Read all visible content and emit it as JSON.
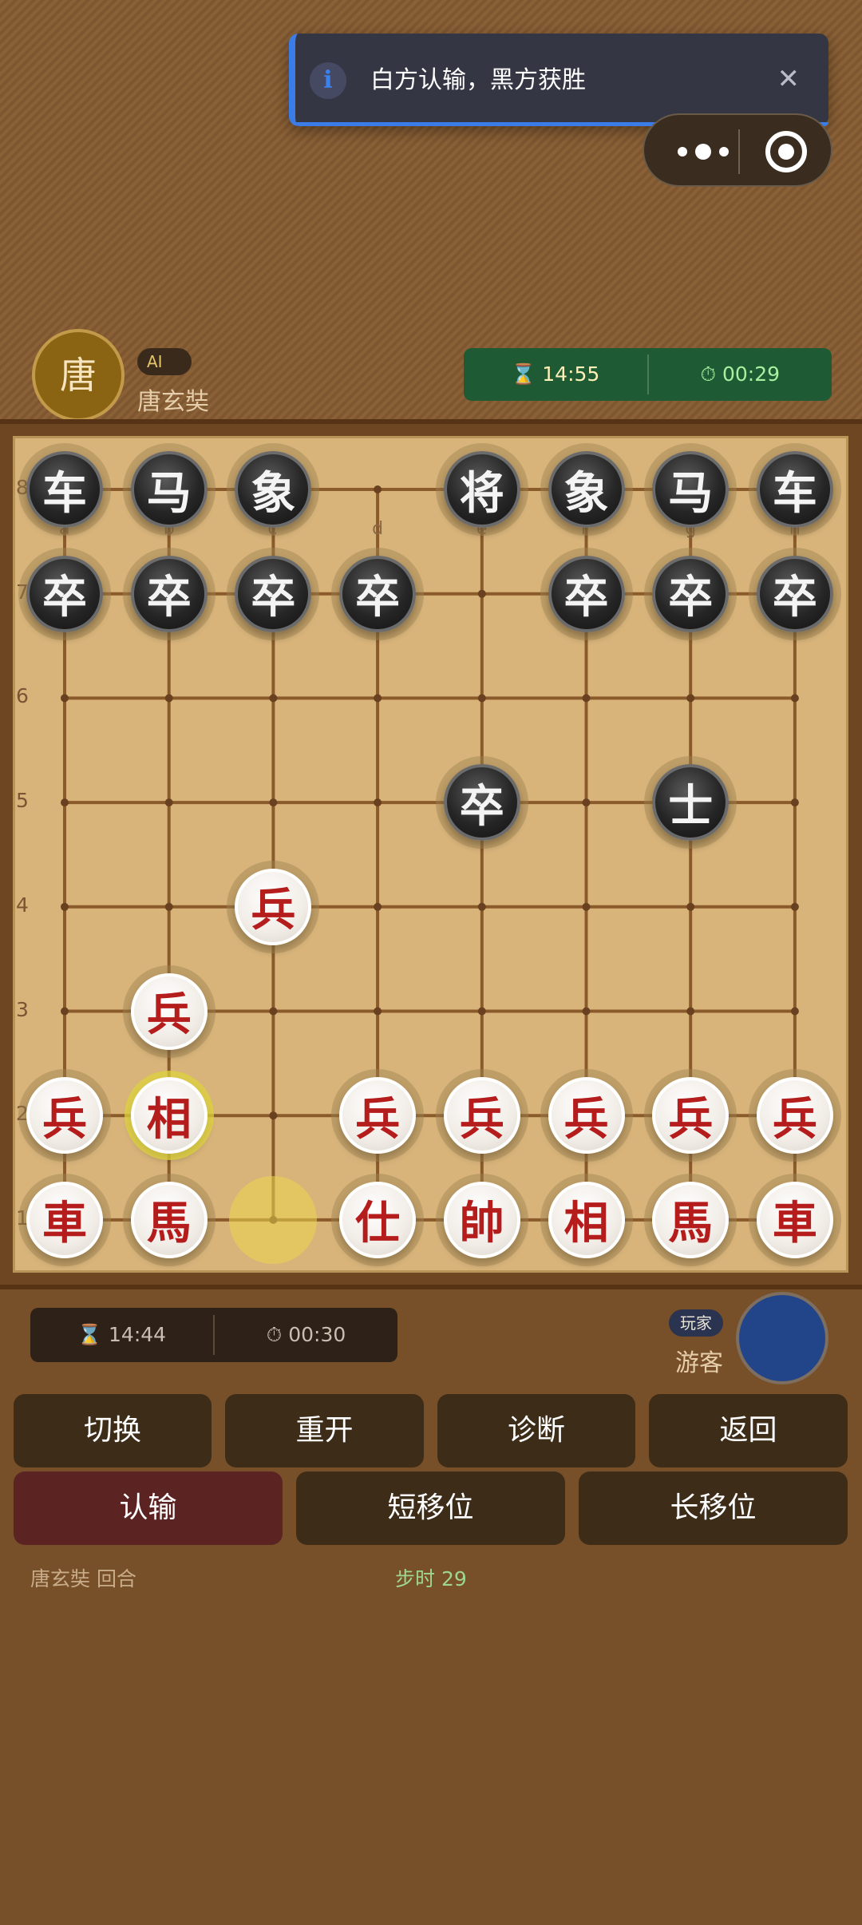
{
  "toast": {
    "icon": "info-icon",
    "message": "白方认输，黑方获胜",
    "close_label": "✕"
  },
  "capsule": {
    "more_icon": "more-dots-icon",
    "close_icon": "target-icon"
  },
  "opponent": {
    "avatar_text": "唐",
    "badge": "AI",
    "name": "唐玄奘",
    "total_time": "14:55",
    "step_time": "00:29",
    "total_icon": "⌛",
    "step_icon": "⏱"
  },
  "player": {
    "badge": "玩家",
    "name": "游客",
    "total_time": "14:44",
    "step_time": "00:30",
    "total_icon": "⌛",
    "step_icon": "⏱"
  },
  "board": {
    "files": [
      "a",
      "b",
      "c",
      "d",
      "e",
      "f",
      "g",
      "h"
    ],
    "ranks": [
      "8",
      "7",
      "6",
      "5",
      "4",
      "3",
      "2",
      "1"
    ],
    "pieces": [
      {
        "char": "车",
        "color": "black",
        "col": 0,
        "row": 0
      },
      {
        "char": "马",
        "color": "black",
        "col": 1,
        "row": 0
      },
      {
        "char": "象",
        "color": "black",
        "col": 2,
        "row": 0
      },
      {
        "char": "将",
        "color": "black",
        "col": 4,
        "row": 0
      },
      {
        "char": "象",
        "color": "black",
        "col": 5,
        "row": 0
      },
      {
        "char": "马",
        "color": "black",
        "col": 6,
        "row": 0
      },
      {
        "char": "车",
        "color": "black",
        "col": 7,
        "row": 0
      },
      {
        "char": "卒",
        "color": "black",
        "col": 0,
        "row": 1
      },
      {
        "char": "卒",
        "color": "black",
        "col": 1,
        "row": 1
      },
      {
        "char": "卒",
        "color": "black",
        "col": 2,
        "row": 1
      },
      {
        "char": "卒",
        "color": "black",
        "col": 3,
        "row": 1
      },
      {
        "char": "卒",
        "color": "black",
        "col": 5,
        "row": 1
      },
      {
        "char": "卒",
        "color": "black",
        "col": 6,
        "row": 1
      },
      {
        "char": "卒",
        "color": "black",
        "col": 7,
        "row": 1
      },
      {
        "char": "卒",
        "color": "black",
        "col": 4,
        "row": 3
      },
      {
        "char": "士",
        "color": "black",
        "col": 6,
        "row": 3
      },
      {
        "char": "兵",
        "color": "red",
        "col": 2,
        "row": 4
      },
      {
        "char": "兵",
        "color": "red",
        "col": 1,
        "row": 5
      },
      {
        "char": "兵",
        "color": "red",
        "col": 0,
        "row": 6
      },
      {
        "char": "相",
        "color": "red",
        "col": 1,
        "row": 6,
        "highlight": true
      },
      {
        "char": "兵",
        "color": "red",
        "col": 3,
        "row": 6
      },
      {
        "char": "兵",
        "color": "red",
        "col": 4,
        "row": 6
      },
      {
        "char": "兵",
        "color": "red",
        "col": 5,
        "row": 6
      },
      {
        "char": "兵",
        "color": "red",
        "col": 6,
        "row": 6
      },
      {
        "char": "兵",
        "color": "red",
        "col": 7,
        "row": 6
      },
      {
        "char": "車",
        "color": "red",
        "col": 0,
        "row": 7
      },
      {
        "char": "馬",
        "color": "red",
        "col": 1,
        "row": 7
      },
      {
        "char": "仕",
        "color": "red",
        "col": 3,
        "row": 7
      },
      {
        "char": "帥",
        "color": "red",
        "col": 4,
        "row": 7
      },
      {
        "char": "相",
        "color": "red",
        "col": 5,
        "row": 7
      },
      {
        "char": "馬",
        "color": "red",
        "col": 6,
        "row": 7
      },
      {
        "char": "車",
        "color": "red",
        "col": 7,
        "row": 7
      }
    ],
    "last_move_marker": {
      "col": 2,
      "row": 7
    }
  },
  "buttons": {
    "switch": "切换",
    "restart": "重开",
    "diagnose": "诊断",
    "back": "返回",
    "resign": "认输",
    "short_castle": "短移位",
    "long_castle": "长移位"
  },
  "status": {
    "turn": "唐玄奘 回合",
    "step_time": "步时 29"
  },
  "colors": {
    "background": "#774f29",
    "board": "#d8b47a",
    "grid_line": "#8b5a2b",
    "timer_top_bg": "#1e5a33",
    "toast_accent": "#3c7ce6",
    "player_avatar": "#224589",
    "resign_button": "#5b2423"
  }
}
